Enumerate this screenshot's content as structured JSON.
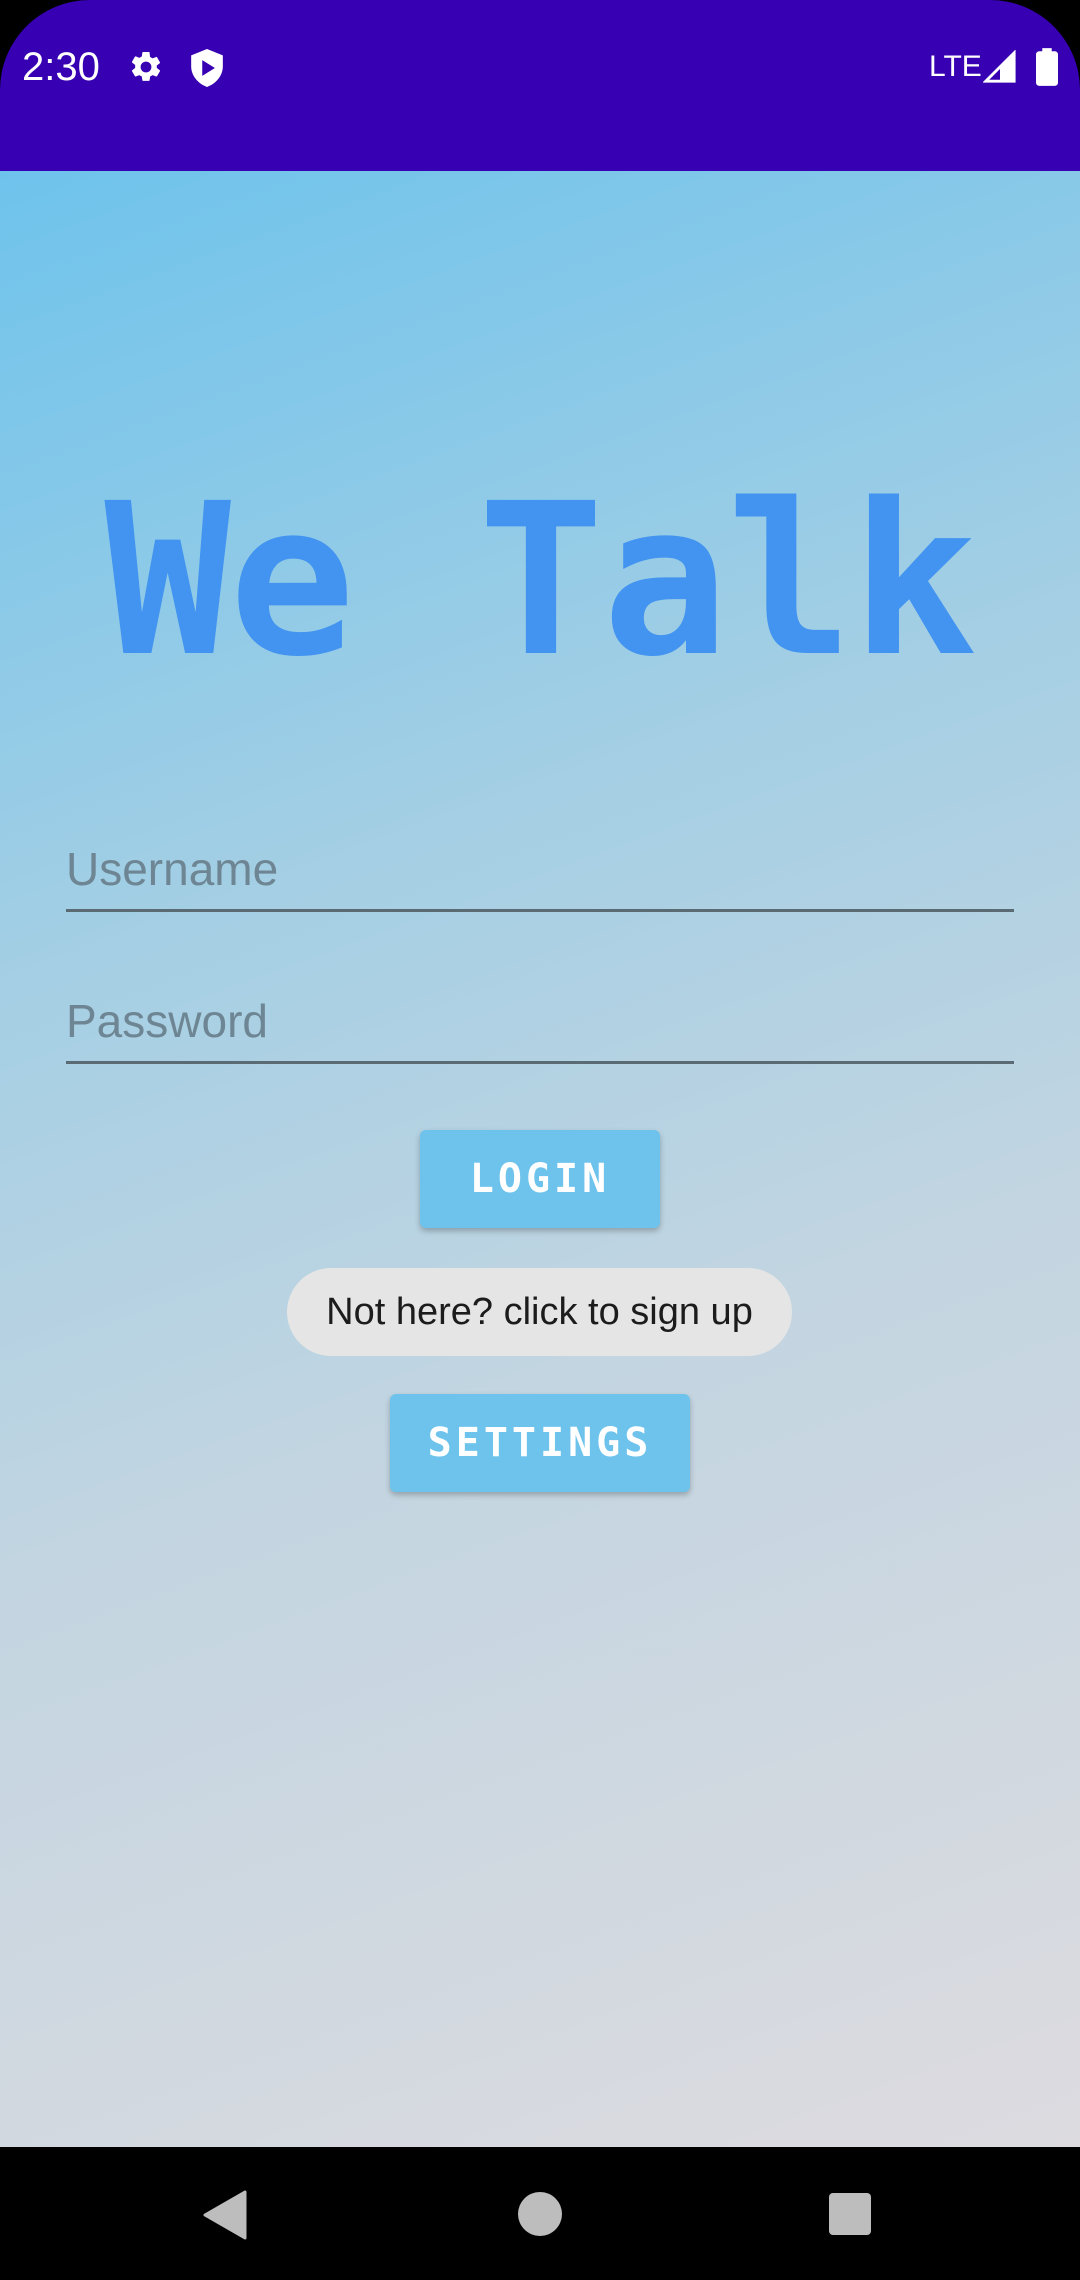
{
  "status_bar": {
    "time": "2:30",
    "network": "LTE",
    "background_color": "#3700b3",
    "icons": [
      "gear-icon",
      "shield-icon",
      "signal-icon",
      "battery-icon"
    ]
  },
  "app": {
    "title": "We Talk",
    "title_color": "#4294f0",
    "username_placeholder": "Username",
    "username_value": "",
    "password_placeholder": "Password",
    "password_value": "",
    "login_label": "LOGIN",
    "signup_label": "Not here? click to sign up",
    "settings_label": "SETTINGS",
    "button_color": "#6ec3ec"
  },
  "nav_bar": {
    "icons": [
      "back-icon",
      "home-icon",
      "recents-icon"
    ]
  }
}
